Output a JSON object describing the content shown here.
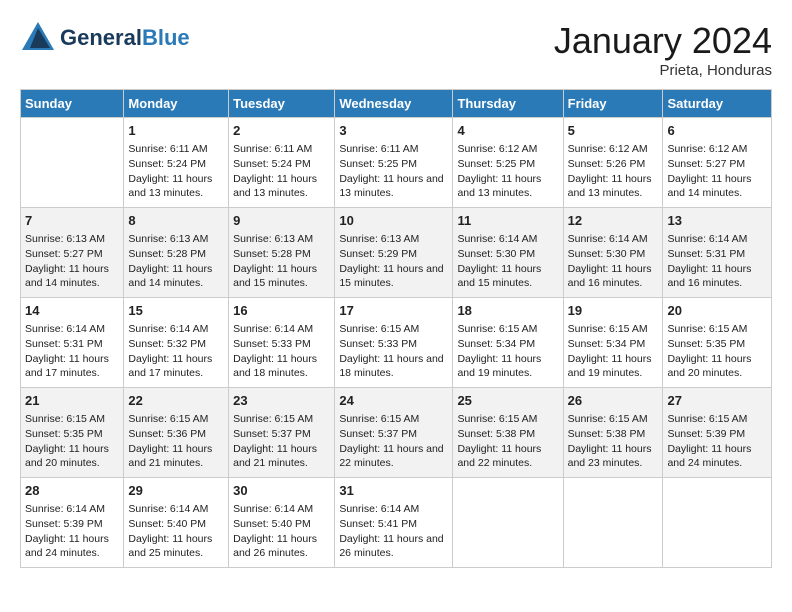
{
  "header": {
    "logo_line1": "General",
    "logo_line2": "Blue",
    "month": "January 2024",
    "location": "Prieta, Honduras"
  },
  "days_of_week": [
    "Sunday",
    "Monday",
    "Tuesday",
    "Wednesday",
    "Thursday",
    "Friday",
    "Saturday"
  ],
  "weeks": [
    [
      {
        "num": "",
        "sunrise": "",
        "sunset": "",
        "daylight": ""
      },
      {
        "num": "1",
        "sunrise": "Sunrise: 6:11 AM",
        "sunset": "Sunset: 5:24 PM",
        "daylight": "Daylight: 11 hours and 13 minutes."
      },
      {
        "num": "2",
        "sunrise": "Sunrise: 6:11 AM",
        "sunset": "Sunset: 5:24 PM",
        "daylight": "Daylight: 11 hours and 13 minutes."
      },
      {
        "num": "3",
        "sunrise": "Sunrise: 6:11 AM",
        "sunset": "Sunset: 5:25 PM",
        "daylight": "Daylight: 11 hours and 13 minutes."
      },
      {
        "num": "4",
        "sunrise": "Sunrise: 6:12 AM",
        "sunset": "Sunset: 5:25 PM",
        "daylight": "Daylight: 11 hours and 13 minutes."
      },
      {
        "num": "5",
        "sunrise": "Sunrise: 6:12 AM",
        "sunset": "Sunset: 5:26 PM",
        "daylight": "Daylight: 11 hours and 13 minutes."
      },
      {
        "num": "6",
        "sunrise": "Sunrise: 6:12 AM",
        "sunset": "Sunset: 5:27 PM",
        "daylight": "Daylight: 11 hours and 14 minutes."
      }
    ],
    [
      {
        "num": "7",
        "sunrise": "Sunrise: 6:13 AM",
        "sunset": "Sunset: 5:27 PM",
        "daylight": "Daylight: 11 hours and 14 minutes."
      },
      {
        "num": "8",
        "sunrise": "Sunrise: 6:13 AM",
        "sunset": "Sunset: 5:28 PM",
        "daylight": "Daylight: 11 hours and 14 minutes."
      },
      {
        "num": "9",
        "sunrise": "Sunrise: 6:13 AM",
        "sunset": "Sunset: 5:28 PM",
        "daylight": "Daylight: 11 hours and 15 minutes."
      },
      {
        "num": "10",
        "sunrise": "Sunrise: 6:13 AM",
        "sunset": "Sunset: 5:29 PM",
        "daylight": "Daylight: 11 hours and 15 minutes."
      },
      {
        "num": "11",
        "sunrise": "Sunrise: 6:14 AM",
        "sunset": "Sunset: 5:30 PM",
        "daylight": "Daylight: 11 hours and 15 minutes."
      },
      {
        "num": "12",
        "sunrise": "Sunrise: 6:14 AM",
        "sunset": "Sunset: 5:30 PM",
        "daylight": "Daylight: 11 hours and 16 minutes."
      },
      {
        "num": "13",
        "sunrise": "Sunrise: 6:14 AM",
        "sunset": "Sunset: 5:31 PM",
        "daylight": "Daylight: 11 hours and 16 minutes."
      }
    ],
    [
      {
        "num": "14",
        "sunrise": "Sunrise: 6:14 AM",
        "sunset": "Sunset: 5:31 PM",
        "daylight": "Daylight: 11 hours and 17 minutes."
      },
      {
        "num": "15",
        "sunrise": "Sunrise: 6:14 AM",
        "sunset": "Sunset: 5:32 PM",
        "daylight": "Daylight: 11 hours and 17 minutes."
      },
      {
        "num": "16",
        "sunrise": "Sunrise: 6:14 AM",
        "sunset": "Sunset: 5:33 PM",
        "daylight": "Daylight: 11 hours and 18 minutes."
      },
      {
        "num": "17",
        "sunrise": "Sunrise: 6:15 AM",
        "sunset": "Sunset: 5:33 PM",
        "daylight": "Daylight: 11 hours and 18 minutes."
      },
      {
        "num": "18",
        "sunrise": "Sunrise: 6:15 AM",
        "sunset": "Sunset: 5:34 PM",
        "daylight": "Daylight: 11 hours and 19 minutes."
      },
      {
        "num": "19",
        "sunrise": "Sunrise: 6:15 AM",
        "sunset": "Sunset: 5:34 PM",
        "daylight": "Daylight: 11 hours and 19 minutes."
      },
      {
        "num": "20",
        "sunrise": "Sunrise: 6:15 AM",
        "sunset": "Sunset: 5:35 PM",
        "daylight": "Daylight: 11 hours and 20 minutes."
      }
    ],
    [
      {
        "num": "21",
        "sunrise": "Sunrise: 6:15 AM",
        "sunset": "Sunset: 5:35 PM",
        "daylight": "Daylight: 11 hours and 20 minutes."
      },
      {
        "num": "22",
        "sunrise": "Sunrise: 6:15 AM",
        "sunset": "Sunset: 5:36 PM",
        "daylight": "Daylight: 11 hours and 21 minutes."
      },
      {
        "num": "23",
        "sunrise": "Sunrise: 6:15 AM",
        "sunset": "Sunset: 5:37 PM",
        "daylight": "Daylight: 11 hours and 21 minutes."
      },
      {
        "num": "24",
        "sunrise": "Sunrise: 6:15 AM",
        "sunset": "Sunset: 5:37 PM",
        "daylight": "Daylight: 11 hours and 22 minutes."
      },
      {
        "num": "25",
        "sunrise": "Sunrise: 6:15 AM",
        "sunset": "Sunset: 5:38 PM",
        "daylight": "Daylight: 11 hours and 22 minutes."
      },
      {
        "num": "26",
        "sunrise": "Sunrise: 6:15 AM",
        "sunset": "Sunset: 5:38 PM",
        "daylight": "Daylight: 11 hours and 23 minutes."
      },
      {
        "num": "27",
        "sunrise": "Sunrise: 6:15 AM",
        "sunset": "Sunset: 5:39 PM",
        "daylight": "Daylight: 11 hours and 24 minutes."
      }
    ],
    [
      {
        "num": "28",
        "sunrise": "Sunrise: 6:14 AM",
        "sunset": "Sunset: 5:39 PM",
        "daylight": "Daylight: 11 hours and 24 minutes."
      },
      {
        "num": "29",
        "sunrise": "Sunrise: 6:14 AM",
        "sunset": "Sunset: 5:40 PM",
        "daylight": "Daylight: 11 hours and 25 minutes."
      },
      {
        "num": "30",
        "sunrise": "Sunrise: 6:14 AM",
        "sunset": "Sunset: 5:40 PM",
        "daylight": "Daylight: 11 hours and 26 minutes."
      },
      {
        "num": "31",
        "sunrise": "Sunrise: 6:14 AM",
        "sunset": "Sunset: 5:41 PM",
        "daylight": "Daylight: 11 hours and 26 minutes."
      },
      {
        "num": "",
        "sunrise": "",
        "sunset": "",
        "daylight": ""
      },
      {
        "num": "",
        "sunrise": "",
        "sunset": "",
        "daylight": ""
      },
      {
        "num": "",
        "sunrise": "",
        "sunset": "",
        "daylight": ""
      }
    ]
  ]
}
